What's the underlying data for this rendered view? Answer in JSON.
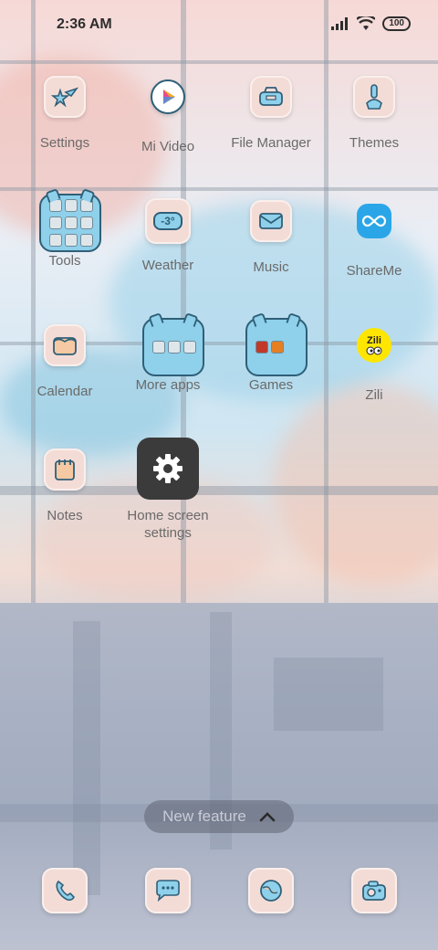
{
  "status_bar": {
    "time": "2:36 AM",
    "battery": "100"
  },
  "apps": [
    {
      "label": "Settings"
    },
    {
      "label": "Mi Video"
    },
    {
      "label": "File Manager"
    },
    {
      "label": "Themes"
    },
    {
      "label": "Tools"
    },
    {
      "label": "Weather",
      "temp": "-3°"
    },
    {
      "label": "Music"
    },
    {
      "label": "ShareMe"
    },
    {
      "label": "Calendar"
    },
    {
      "label": "More apps"
    },
    {
      "label": "Games"
    },
    {
      "label": "Zili",
      "badge": "Zili"
    },
    {
      "label": "Notes"
    },
    {
      "label": "Home screen settings"
    }
  ],
  "new_feature": {
    "label": "New feature"
  },
  "dock": [
    {
      "icon": "phone-icon"
    },
    {
      "icon": "messages-icon"
    },
    {
      "icon": "browser-icon"
    },
    {
      "icon": "camera-icon"
    }
  ],
  "colors": {
    "tile": "#f4dcd6",
    "folder": "#8fd0ea",
    "outline": "#2f5f78"
  }
}
